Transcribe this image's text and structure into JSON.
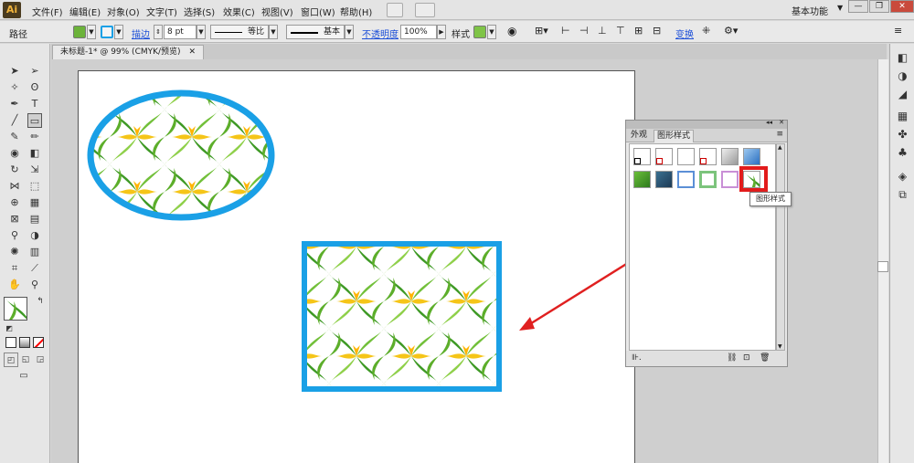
{
  "app": {
    "logo": "Ai",
    "workspace": "基本功能"
  },
  "menu": [
    "文件(F)",
    "编辑(E)",
    "对象(O)",
    "文字(T)",
    "选择(S)",
    "效果(C)",
    "视图(V)",
    "窗口(W)",
    "帮助(H)"
  ],
  "window_controls": {
    "minimize": "—",
    "restore": "❐",
    "close": "✕"
  },
  "control": {
    "selection_label": "路径",
    "stroke_link": "描边",
    "stroke_weight": "8 pt",
    "profile_uniform": "等比",
    "brush_basic": "基本",
    "opacity_link": "不透明度",
    "opacity_value": "100%",
    "style_label": "样式",
    "transform_link": "变换"
  },
  "document": {
    "tab_title": "未标题-1* @ 99% (CMYK/预览)"
  },
  "panel": {
    "tab_appearance": "外观",
    "tab_graphic_styles": "图形样式",
    "tooltip": "图形样式"
  },
  "colors": {
    "accent_blue": "#1aa0e6",
    "highlight_red": "#e21b1b",
    "arrow_red": "#e02020",
    "pattern_green": "#5cae2a",
    "pattern_yellow": "#f5c518"
  }
}
